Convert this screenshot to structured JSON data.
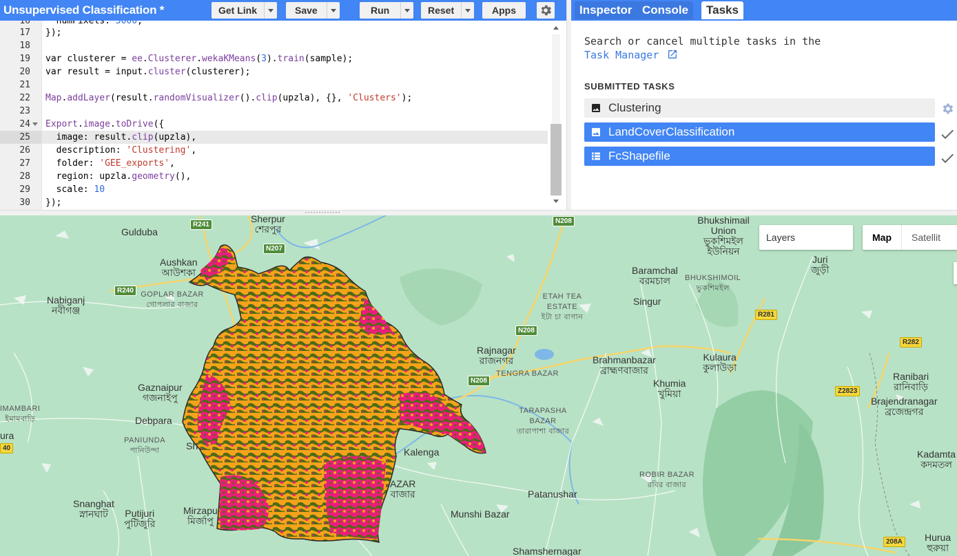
{
  "header": {
    "title": "Unsupervised Classification *",
    "get_link": "Get Link",
    "save": "Save",
    "run": "Run",
    "reset": "Reset",
    "apps": "Apps"
  },
  "editor": {
    "lines": [
      {
        "n": "16",
        "text": "  numPixels: 5000,"
      },
      {
        "n": "17",
        "text": "});"
      },
      {
        "n": "18",
        "text": ""
      },
      {
        "n": "19",
        "text": "var clusterer = ee.Clusterer.wekaKMeans(3).train(sample);"
      },
      {
        "n": "20",
        "text": "var result = input.cluster(clusterer);"
      },
      {
        "n": "21",
        "text": ""
      },
      {
        "n": "22",
        "text": "Map.addLayer(result.randomVisualizer().clip(upzla), {}, 'Clusters');"
      },
      {
        "n": "23",
        "text": ""
      },
      {
        "n": "24",
        "text": "Export.image.toDrive({"
      },
      {
        "n": "25",
        "text": "  image: result.clip(upzla),"
      },
      {
        "n": "26",
        "text": "  description: 'Clustering',"
      },
      {
        "n": "27",
        "text": "  folder: 'GEE_exports',"
      },
      {
        "n": "28",
        "text": "  region: upzla.geometry(),"
      },
      {
        "n": "29",
        "text": "  scale: 10"
      },
      {
        "n": "30",
        "text": "});"
      }
    ]
  },
  "right_panel": {
    "tabs": [
      "Inspector",
      "Console",
      "Tasks"
    ],
    "selected_tab": "Tasks",
    "info_line1": "Search or cancel multiple tasks in the",
    "task_manager_link": "Task Manager",
    "submitted_heading": "SUBMITTED TASKS",
    "tasks": [
      {
        "name": "Clustering",
        "state": "running",
        "icon": "image-icon"
      },
      {
        "name": "LandCoverClassification",
        "state": "completed",
        "icon": "image-icon"
      },
      {
        "name": "FcShapefile",
        "state": "completed",
        "icon": "table-icon"
      }
    ]
  },
  "map": {
    "layers_label": "Layers",
    "map_button": "Map",
    "satellite_button": "Satellit",
    "places": [
      {
        "en": "Sherpur",
        "bn": "শেরপুর"
      },
      {
        "en": "Gulduba",
        "bn": ""
      },
      {
        "en": "Aushkan",
        "bn": "আউশকা"
      },
      {
        "en": "GOPLAR BAZAR",
        "bn": "গোপলার বাজার"
      },
      {
        "en": "Nabiganj",
        "bn": "নবীগঞ্জ"
      },
      {
        "en": "Bhukshimail Union",
        "bn": "ভুকশিমইল ইউনিয়ন"
      },
      {
        "en": "Baramchal",
        "bn": "বরমচাল"
      },
      {
        "en": "BHUKSHIMOIL",
        "bn": "ভুকশিমইল"
      },
      {
        "en": "Juri",
        "bn": "জুড়ী"
      },
      {
        "en": "ETAH TEA ESTATE",
        "bn": "ইটা চা বাগান"
      },
      {
        "en": "Singur",
        "bn": ""
      },
      {
        "en": "Rajnagar",
        "bn": "রাজনগর"
      },
      {
        "en": "Brahmanbazar",
        "bn": "ব্রাহ্মণবাজার"
      },
      {
        "en": "Kulaura",
        "bn": "কুলাউড়া"
      },
      {
        "en": "TENGRA BAZAR",
        "bn": ""
      },
      {
        "en": "Khumia",
        "bn": "খুমিয়া"
      },
      {
        "en": "Ranibari",
        "bn": "রানিবাড়ি"
      },
      {
        "en": "Brajendranagar",
        "bn": "ব্রজেন্দ্রগর"
      },
      {
        "en": "Gaznaipur",
        "bn": "গজনাইপু"
      },
      {
        "en": "IMAMBARI",
        "bn": "ইমামবাড়ি"
      },
      {
        "en": "Debpara",
        "bn": ""
      },
      {
        "en": "PANIUNDA",
        "bn": "পানিউন্দা"
      },
      {
        "en": "TARAPASHA BAZAR",
        "bn": "তারাপাশা বাজার"
      },
      {
        "en": "Kalenga",
        "bn": ""
      },
      {
        "en": "Kadamta",
        "bn": "কদমতল"
      },
      {
        "en": "ROBIR BAZAR",
        "bn": "রবির বাজার"
      },
      {
        "en": "Snanghat",
        "bn": "স্নানঘাট"
      },
      {
        "en": "Putijuri",
        "bn": "পুটিজুরি"
      },
      {
        "en": "Mirzapu",
        "bn": "মির্জাপু"
      },
      {
        "en": "Patanushar",
        "bn": ""
      },
      {
        "en": "Munshi Bazar",
        "bn": ""
      },
      {
        "en": "Shamshernagar",
        "bn": ""
      },
      {
        "en": "Hurua",
        "bn": "হুরুয়া"
      },
      {
        "en": "ura",
        "bn": ""
      },
      {
        "en": "Sh",
        "bn": ""
      },
      {
        "en": "AZAR",
        "bn": "বাজার"
      }
    ],
    "roads": [
      "R241",
      "N207",
      "N208",
      "R240",
      "N208",
      "N208",
      "R281",
      "R282",
      "Z2823",
      "40",
      "208A"
    ],
    "cluster_colors": [
      "#e91e7a",
      "#f5a31a",
      "#4f6b16"
    ]
  }
}
